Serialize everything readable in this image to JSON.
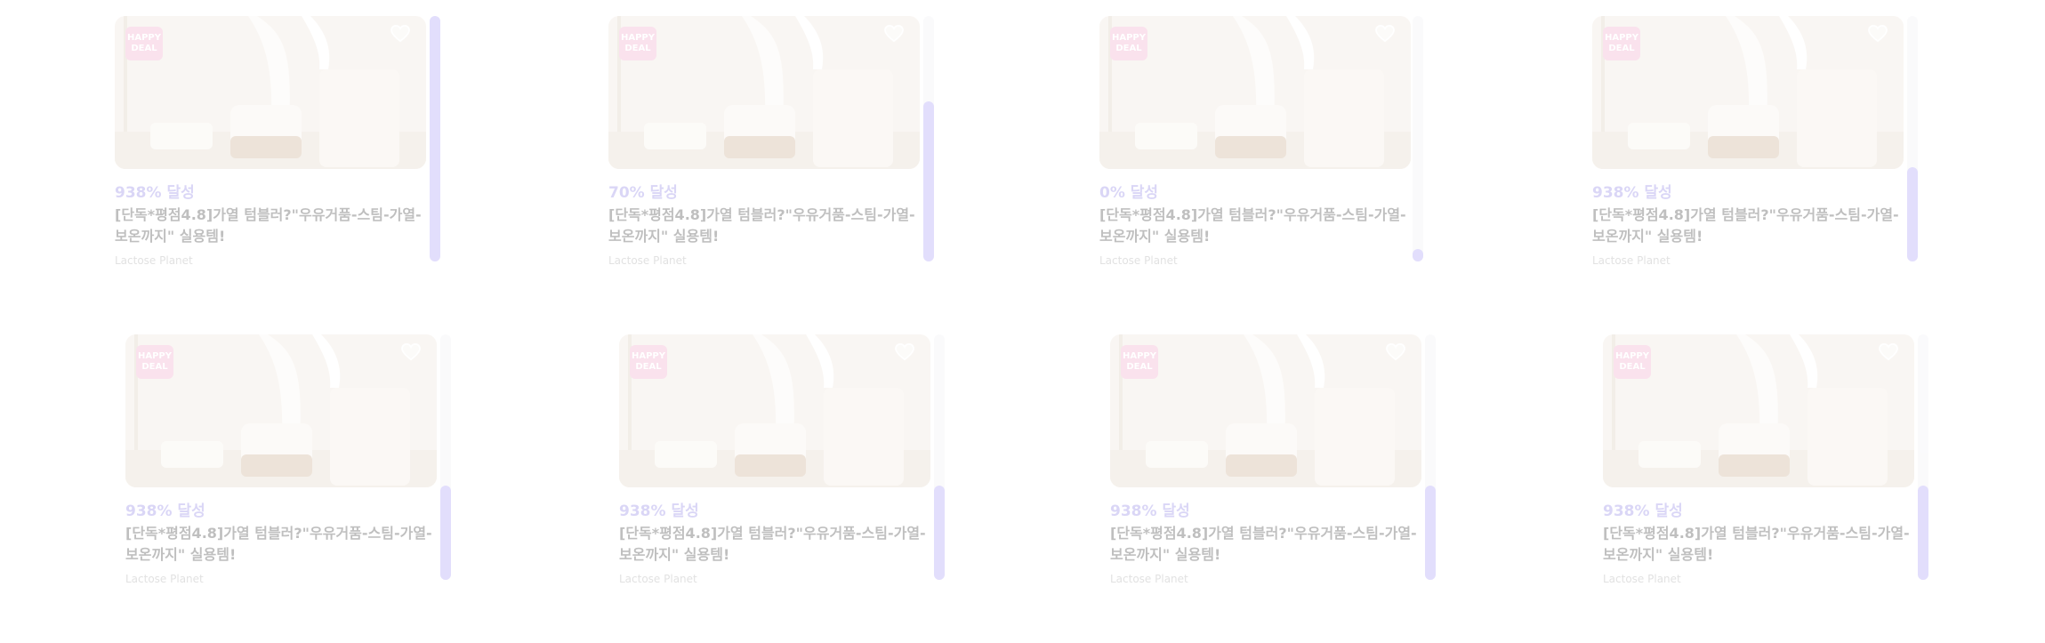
{
  "colors": {
    "accent": "#8d83e6",
    "badge": "#f2a6c9",
    "scroll_thumb": "#a79af7",
    "scroll_track": "#f1f1f5"
  },
  "cards": [
    {
      "percent": "938% 달성",
      "title": "[단독*평점4.8]가열 텀블러?\"우유거품-스팀-가열-보온까지\" 실용템!",
      "maker": "Lactose Planet",
      "badge_line1": "HAPPY",
      "badge_line2": "DEAL",
      "heart_icon": "heart-outline-icon"
    },
    {
      "percent": "70% 달성",
      "title": "[단독*평점4.8]가열 텀블러?\"우유거품-스팀-가열-보온까지\" 실용템!",
      "maker": "Lactose Planet",
      "badge_line1": "HAPPY",
      "badge_line2": "DEAL",
      "heart_icon": "heart-outline-icon"
    },
    {
      "percent": "0% 달성",
      "title": "[단독*평점4.8]가열 텀블러?\"우유거품-스팀-가열-보온까지\" 실용템!",
      "maker": "Lactose Planet",
      "badge_line1": "HAPPY",
      "badge_line2": "DEAL",
      "heart_icon": "heart-outline-icon"
    },
    {
      "percent": "938% 달성",
      "title": "[단독*평점4.8]가열 텀블러?\"우유거품-스팀-가열-보온까지\" 실용템!",
      "maker": "Lactose Planet",
      "badge_line1": "HAPPY",
      "badge_line2": "DEAL",
      "heart_icon": "heart-outline-icon"
    },
    {
      "percent": "938% 달성",
      "title": "[단독*평점4.8]가열 텀블러?\"우유거품-스팀-가열-보온까지\" 실용템!",
      "maker": "Lactose Planet",
      "badge_line1": "HAPPY",
      "badge_line2": "DEAL",
      "heart_icon": "heart-outline-icon"
    },
    {
      "percent": "938% 달성",
      "title": "[단독*평점4.8]가열 텀블러?\"우유거품-스팀-가열-보온까지\" 실용템!",
      "maker": "Lactose Planet",
      "badge_line1": "HAPPY",
      "badge_line2": "DEAL",
      "heart_icon": "heart-outline-icon"
    },
    {
      "percent": "938% 달성",
      "title": "[단독*평점4.8]가열 텀블러?\"우유거품-스팀-가열-보온까지\" 실용템!",
      "maker": "Lactose Planet",
      "badge_line1": "HAPPY",
      "badge_line2": "DEAL",
      "heart_icon": "heart-outline-icon"
    },
    {
      "percent": "938% 달성",
      "title": "[단독*평점4.8]가열 텀블러?\"우유거품-스팀-가열-보온까지\" 실용템!",
      "maker": "Lactose Planet",
      "badge_line1": "HAPPY",
      "badge_line2": "DEAL",
      "heart_icon": "heart-outline-icon"
    }
  ]
}
